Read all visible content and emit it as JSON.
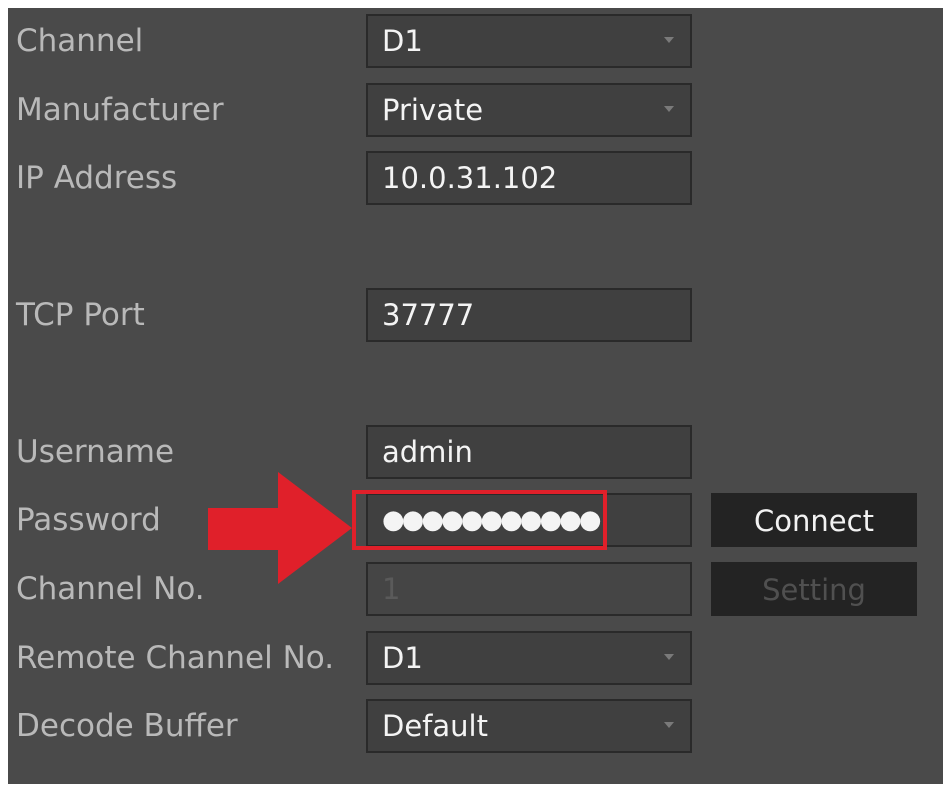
{
  "form": {
    "channel": {
      "label": "Channel",
      "value": "D1"
    },
    "manufacturer": {
      "label": "Manufacturer",
      "value": "Private"
    },
    "ip_address": {
      "label": "IP Address",
      "value": "10.0.31.102"
    },
    "tcp_port": {
      "label": "TCP Port",
      "value": "37777"
    },
    "username": {
      "label": "Username",
      "value": "admin"
    },
    "password": {
      "label": "Password",
      "value": "●●●●●●●●●●●"
    },
    "channel_no": {
      "label": "Channel No.",
      "value": "1"
    },
    "remote_channel_no": {
      "label": "Remote Channel No.",
      "value": "D1"
    },
    "decode_buffer": {
      "label": "Decode Buffer",
      "value": "Default"
    }
  },
  "buttons": {
    "connect": "Connect",
    "setting": "Setting"
  },
  "annotation": {
    "color": "#e0202a",
    "arrow_icon": "arrow-right-icon"
  },
  "theme": {
    "panel_bg": "#4a4a4a",
    "field_bg": "#404040",
    "button_bg": "#232323"
  }
}
